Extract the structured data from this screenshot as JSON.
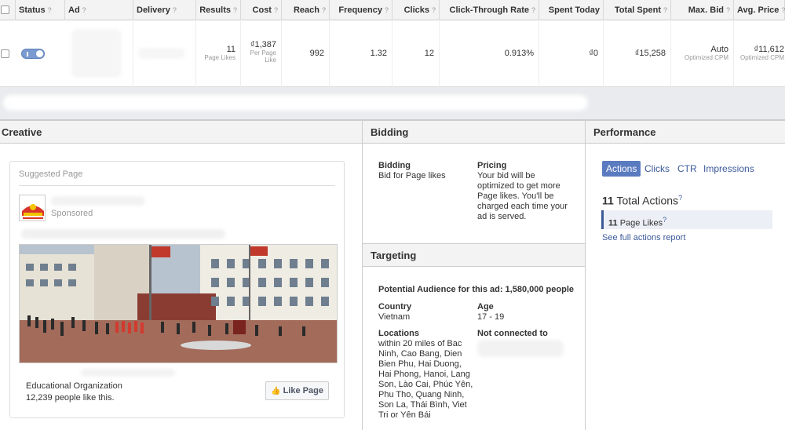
{
  "table": {
    "headers": [
      {
        "label": "Status",
        "q": "?"
      },
      {
        "label": "Ad",
        "q": "?"
      },
      {
        "label": "Delivery",
        "q": "?"
      },
      {
        "label": "Results",
        "q": "?"
      },
      {
        "label": "Cost",
        "q": "?"
      },
      {
        "label": "Reach",
        "q": "?"
      },
      {
        "label": "Frequency",
        "q": "?"
      },
      {
        "label": "Clicks",
        "q": "?"
      },
      {
        "label": "Click-Through Rate",
        "q": "?"
      },
      {
        "label": "Spent Today",
        "q": ""
      },
      {
        "label": "Total Spent",
        "q": "?"
      },
      {
        "label": "Max. Bid",
        "q": "?"
      },
      {
        "label": "Avg. Price",
        "q": "?"
      }
    ],
    "row": {
      "results": "11",
      "results_sub": "Page Likes",
      "cost": "₫1,387",
      "cost_sub1": "Per Page",
      "cost_sub2": "Like",
      "reach": "992",
      "frequency": "1.32",
      "clicks": "12",
      "ctr": "0.913%",
      "spent_today": "₫0",
      "total_spent": "₫15,258",
      "max_bid": "Auto",
      "max_bid_sub": "Optimized CPM",
      "avg_price": "₫11,612",
      "avg_price_sub": "Optimized CPM"
    }
  },
  "creative": {
    "title": "Creative",
    "suggested": "Suggested Page",
    "sponsored": "Sponsored",
    "category": "Educational Organization",
    "likes": "12,239 people like this.",
    "like_button": "Like Page"
  },
  "bidding": {
    "title": "Bidding",
    "bidding_label": "Bidding",
    "bidding_value": "Bid for Page likes",
    "pricing_label": "Pricing",
    "pricing_lines": [
      "Your bid will be",
      "optimized to get more",
      "Page likes. You'll be",
      "charged each time your",
      "ad is served."
    ]
  },
  "targeting": {
    "title": "Targeting",
    "audience": "Potential Audience for this ad: 1,580,000 people",
    "country_label": "Country",
    "country": "Vietnam",
    "age_label": "Age",
    "age": "17 - 19",
    "locations_label": "Locations",
    "locations_lines": [
      "within 20 miles of Bac",
      "Ninh, Cao Bang, Dien",
      "Bien Phu, Hai Duong,",
      "Hai Phong, Hanoi, Lang",
      "Son, Lào Cai, Phúc Yên,",
      "Phu Tho, Quang Ninh,",
      "Son La, Thái Bình, Viet",
      "Tri or Yên Bái"
    ],
    "not_connected_label": "Not connected to"
  },
  "performance": {
    "title": "Performance",
    "tabs": [
      "Actions",
      "Clicks",
      "CTR",
      "Impressions"
    ],
    "total_num": "11",
    "total_label": "Total Actions",
    "total_q": "?",
    "item_num": "11",
    "item_label": "Page Likes",
    "item_q": "?",
    "report_link": "See full actions report"
  },
  "colors": {
    "accent": "#3b5998",
    "tab_active": "#5b7bc0"
  }
}
